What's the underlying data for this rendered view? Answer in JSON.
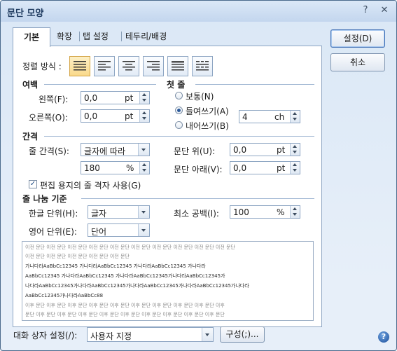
{
  "window": {
    "title": "문단 모양",
    "help": "?",
    "close": "✕"
  },
  "tabs": [
    "기본",
    "확장",
    "탭 설정",
    "테두리/배경"
  ],
  "alignment": {
    "label": "정렬 방식 :",
    "options": [
      "justify-icon",
      "left-icon",
      "center-icon",
      "right-icon",
      "distribute-icon",
      "divide-icon"
    ],
    "selected": 0
  },
  "margins": {
    "section": "여백",
    "left": {
      "label": "왼쪽(F):",
      "value": "0,0",
      "unit": "pt"
    },
    "right": {
      "label": "오른쪽(O):",
      "value": "0,0",
      "unit": "pt"
    }
  },
  "first_line": {
    "section": "첫 줄",
    "normal": "보통(N)",
    "indent": "들여쓰기(A)",
    "outdent": "내어쓰기(B)",
    "selected": "indent",
    "value": "4",
    "unit": "ch"
  },
  "spacing": {
    "section": "간격",
    "line_label": "줄 간격(S):",
    "line_type": "글자에 따라",
    "line_value": "180",
    "line_unit": "%",
    "above_label": "문단 위(U):",
    "above_value": "0,0",
    "above_unit": "pt",
    "below_label": "문단 아래(V):",
    "below_value": "0,0",
    "below_unit": "pt",
    "grid_label": "편집 용지의 줄 격자 사용(G)",
    "grid_checked": true
  },
  "line_break": {
    "section": "줄 나눔 기준",
    "korean_label": "한글 단위(H):",
    "korean_value": "글자",
    "english_label": "영어 단위(E):",
    "english_value": "단어",
    "min_space_label": "최소 공백(I):",
    "min_space_value": "100",
    "min_space_unit": "%"
  },
  "preview": {
    "lines": [
      "이전 문단 이전 문단 이전 문단 이전 문단 이전 문단 이전 문단 이전 문단 이전 문단 이전 문단 이전 문단",
      "이전 문단 이전 문단 이전 문단 이전 문단 이전 문단",
      "      가나다라AaBbCc12345   가나다라AaBbCc12345   가나다라AaBbCc12345   가나다라",
      "AaBbCc12345   가나다라AaBbCc12345   가나다라AaBbCc12345가나다라AaBbCc12345가",
      "나다라AaBbCc12345가나다라AaBbCc12345가나다라AaBbCc12345가나다라AaBbCc12345가나다라",
      "AaBbCc12345가나다라AaBbCc88",
      "이후 문단 이후 문단 이후 문단 이후 문단 이후 문단 이후 문단 이후 문단 이후 문단 이후 문단 이후",
      "문단 이후 문단 이후 문단 이후 문단 이후 문단 이후 문단 이후 문단 이후 문단 이후 문단 이후 문단"
    ]
  },
  "buttons": {
    "ok": "설정(D)",
    "cancel": "취소"
  },
  "bottom": {
    "settings_label": "대화 상자 설정(/):",
    "settings_value": "사용자 지정",
    "compose": "구성(;)..."
  }
}
